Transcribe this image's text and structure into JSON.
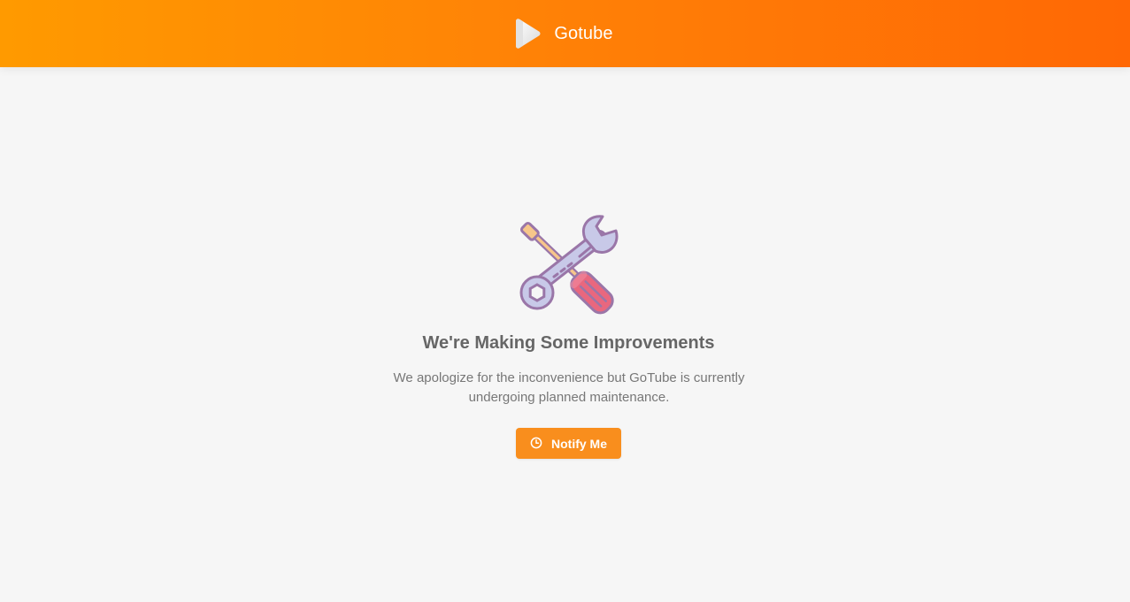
{
  "header": {
    "brand_name": "Gotube",
    "logo_icon": "play-logo-icon"
  },
  "maintenance": {
    "illustration": "wrench-screwdriver-icon",
    "title": "We're Making Some Improvements",
    "message": "We apologize for the inconvenience but GoTube is currently undergoing planned maintenance.",
    "notify_button": {
      "label": "Notify Me",
      "icon": "clock-icon"
    }
  },
  "colors": {
    "header_gradient_start": "#ff9a00",
    "header_gradient_end": "#ff6805",
    "background": "#f6f6f6",
    "button": "#f98e1d",
    "heading_text": "#666666",
    "body_text": "#777777",
    "tool_outline": "#9a76a8",
    "wrench_fill": "#c8c9e8",
    "handle_fill": "#e9677e",
    "screwdriver_tip": "#f7c68a"
  }
}
